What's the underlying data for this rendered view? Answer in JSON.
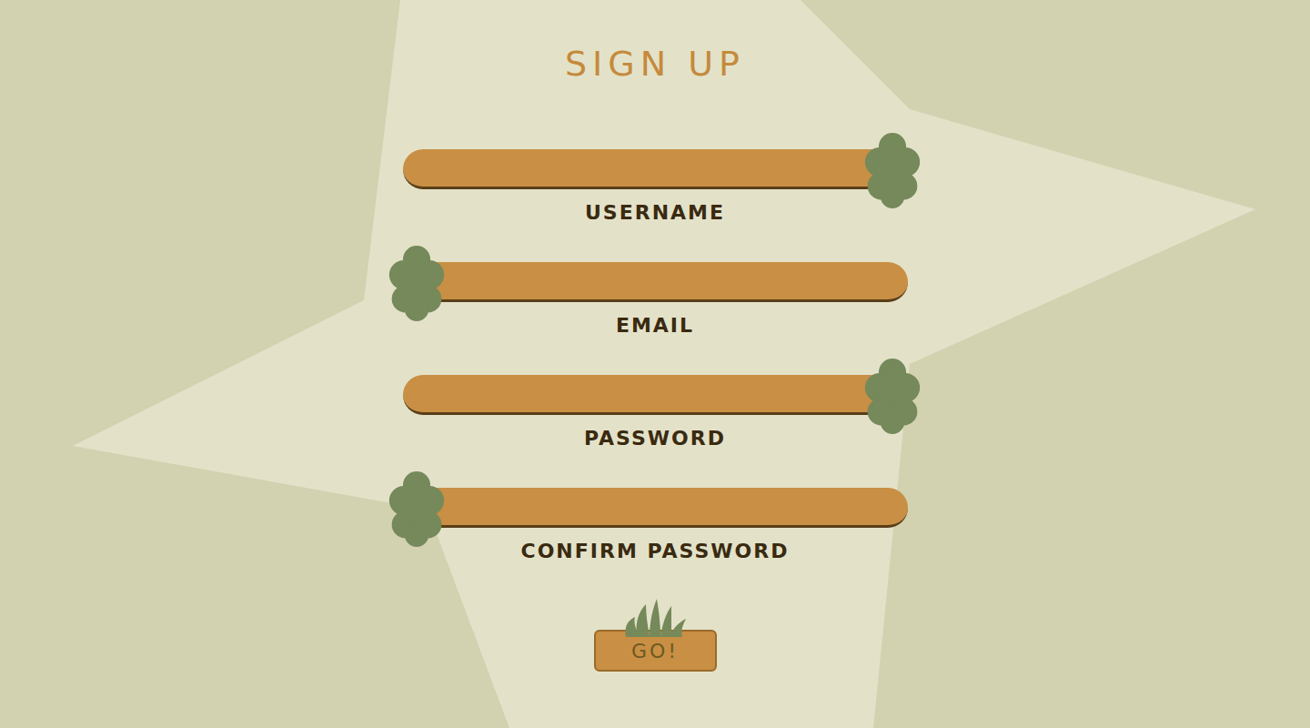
{
  "title": "SIGN UP",
  "fields": [
    {
      "label": "USERNAME",
      "kind": "right"
    },
    {
      "label": "EMAIL",
      "kind": "left"
    },
    {
      "label": "PASSWORD",
      "kind": "right"
    },
    {
      "label": "CONFIRM PASSWORD",
      "kind": "left"
    }
  ],
  "button": {
    "label": "GO!"
  }
}
